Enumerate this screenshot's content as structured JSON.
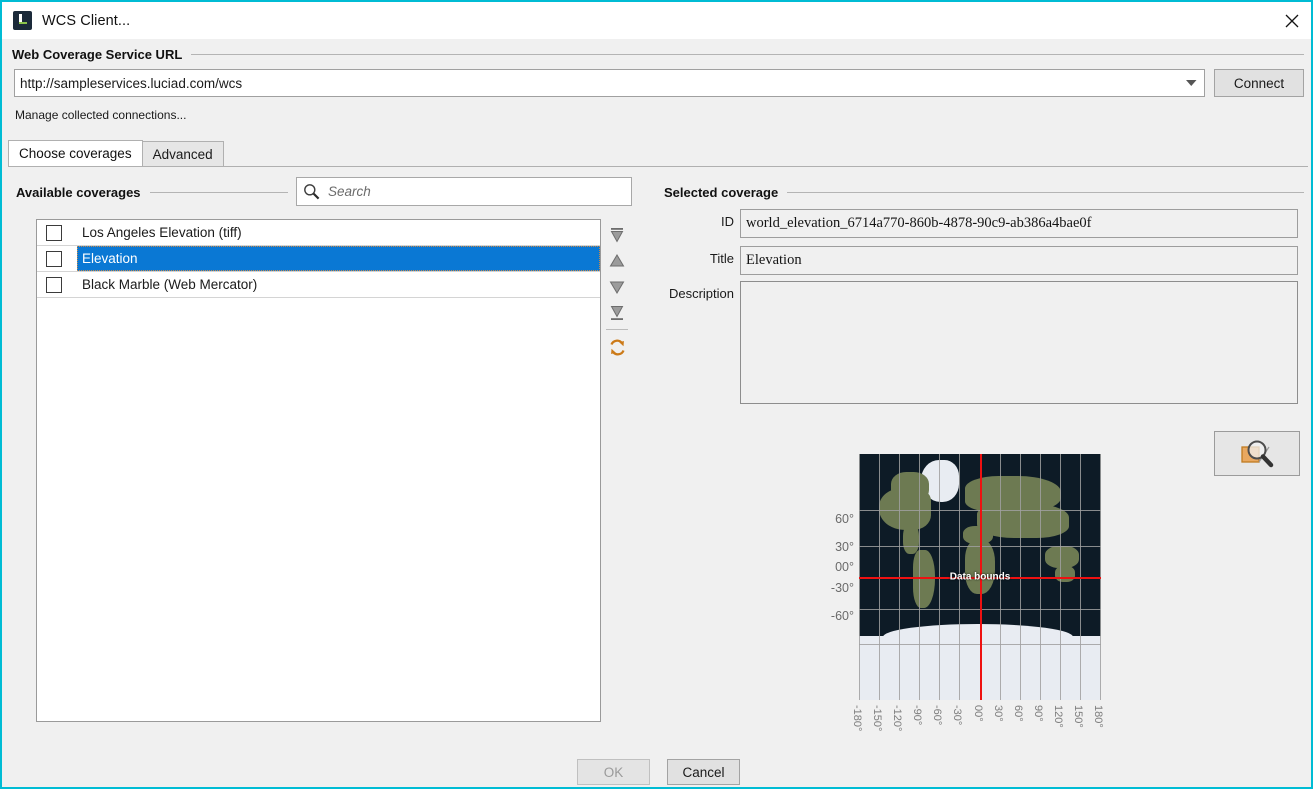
{
  "window": {
    "title": "WCS Client...",
    "app_icon": "luciad-l-icon",
    "close_icon": "close-icon",
    "accent_color": "#00bcd4"
  },
  "url_section": {
    "heading": "Web Coverage Service URL",
    "url_value": "http://sampleservices.luciad.com/wcs",
    "dropdown_icon": "chevron-down-icon",
    "connect_label": "Connect",
    "manage_link": "Manage collected connections..."
  },
  "tabs": [
    {
      "label": "Choose coverages",
      "active": true
    },
    {
      "label": "Advanced",
      "active": false
    }
  ],
  "available": {
    "heading": "Available coverages",
    "search_placeholder": "Search",
    "search_value": "",
    "search_icon": "search-icon",
    "rows": [
      {
        "label": "Los Angeles Elevation (tiff)",
        "checked": false,
        "selected": false
      },
      {
        "label": "Elevation",
        "checked": false,
        "selected": true
      },
      {
        "label": "Black Marble (Web Mercator)",
        "checked": false,
        "selected": false
      }
    ],
    "tools": [
      {
        "name": "move-to-top-icon",
        "title": "Move to top"
      },
      {
        "name": "move-up-icon",
        "title": "Move up"
      },
      {
        "name": "move-down-icon",
        "title": "Move down"
      },
      {
        "name": "move-to-bottom-icon",
        "title": "Move to bottom"
      },
      {
        "name": "refresh-icon",
        "title": "Refresh"
      }
    ]
  },
  "selected_coverage": {
    "heading": "Selected coverage",
    "id_label": "ID",
    "id_value": "world_elevation_6714a770-860b-4878-90c9-ab386a4bae0f",
    "title_label": "Title",
    "title_value": "Elevation",
    "description_label": "Description",
    "description_value": "",
    "fit_button_icon": "zoom-to-bounds-icon"
  },
  "map_preview": {
    "bounds_label": "Data bounds",
    "lat_labels": [
      "60°",
      "30°",
      "00°",
      "-30°",
      "-60°"
    ],
    "lon_labels": [
      "-180°",
      "-150°",
      "-120°",
      "-90°",
      "-60°",
      "-30°",
      "00°",
      "30°",
      "60°",
      "90°",
      "120°",
      "150°",
      "180°"
    ],
    "bounds_color": "#ee1111"
  },
  "footer": {
    "ok_label": "OK",
    "ok_enabled": false,
    "cancel_label": "Cancel",
    "cancel_enabled": true
  }
}
